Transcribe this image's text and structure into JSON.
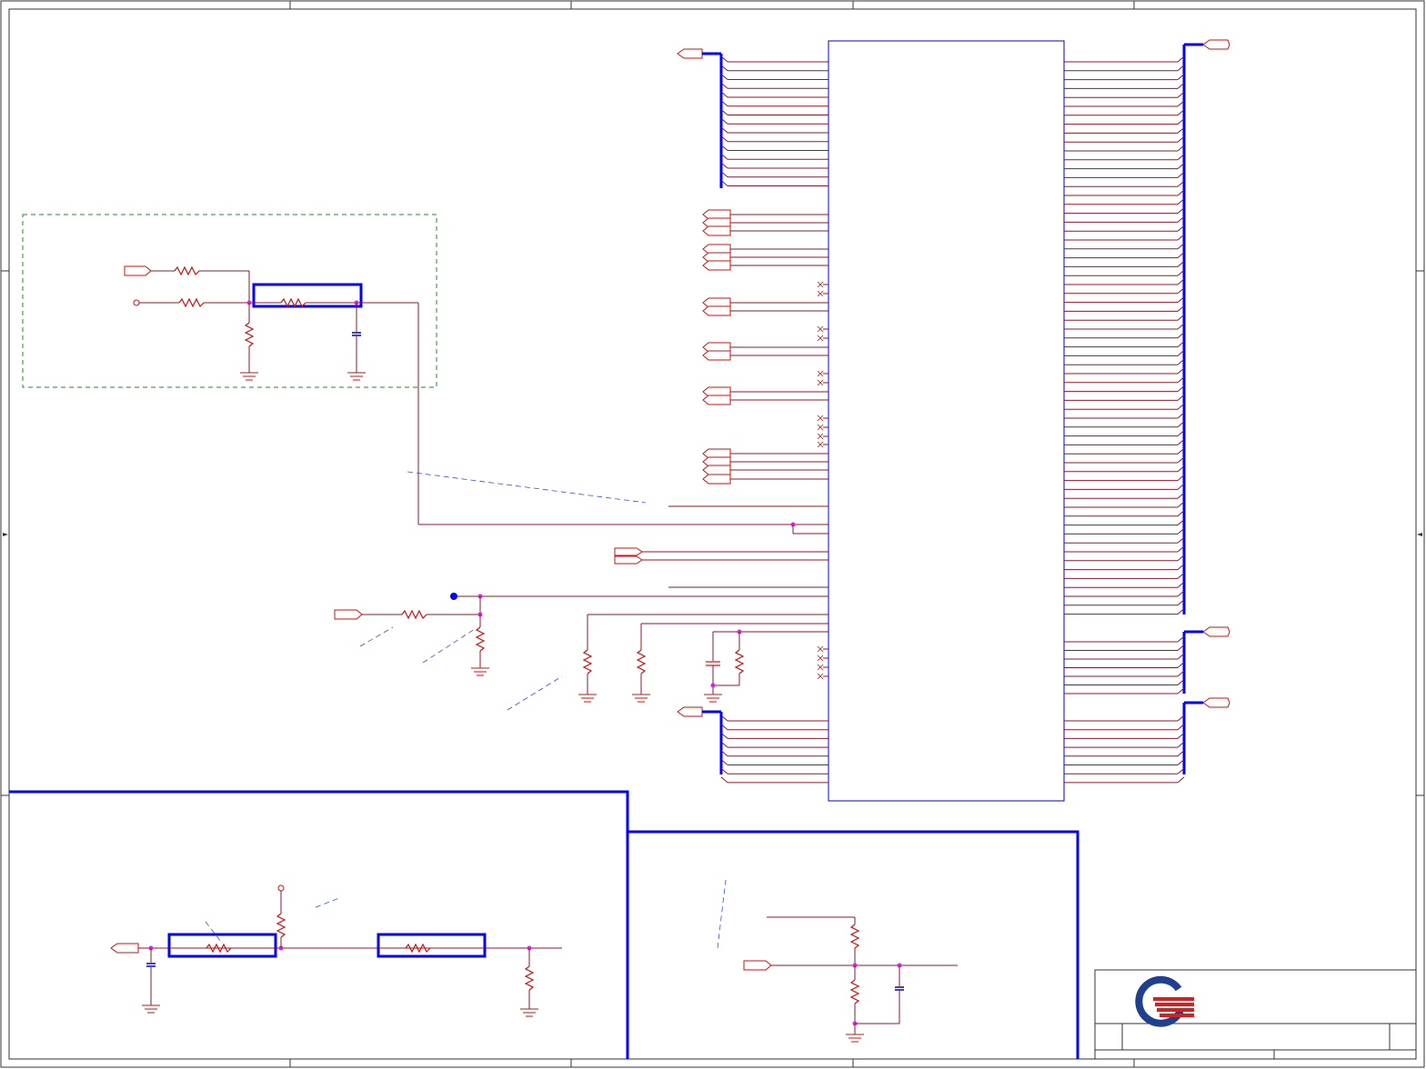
{
  "page": {
    "background": "#ffffff"
  },
  "colors": {
    "wire": "#8b1a2e",
    "bus": "#0000ff",
    "component": "#cc1111",
    "junction": "#e020e0",
    "frame_group": "#2a8a2a",
    "logo_blue": "#1f3f8f",
    "logo_red": "#d62020"
  },
  "schematic": {
    "description_text": [],
    "title_block": {
      "logo_icon": "company-logo-icon"
    }
  }
}
